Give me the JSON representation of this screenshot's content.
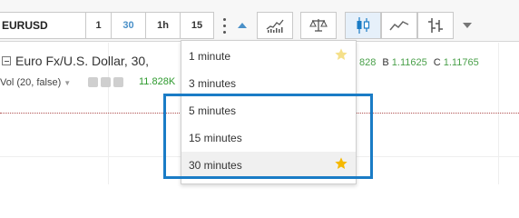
{
  "toolbar": {
    "symbol": "EURUSD",
    "timeframes": [
      "1",
      "30",
      "1h",
      "15"
    ],
    "active_timeframe": "30",
    "icons": [
      "more-options-icon",
      "collapse-caret-icon",
      "indicators-icon",
      "compare-icon",
      "candles-icon",
      "line-chart-icon",
      "bars-icon",
      "chevron-down-icon"
    ]
  },
  "legend": {
    "title": "Euro Fx/U.S. Dollar, 30,",
    "ohlc": [
      {
        "label": "",
        "value": "828"
      },
      {
        "label": "B",
        "value": "1.11625"
      },
      {
        "label": "C",
        "value": "1.11765"
      }
    ],
    "volume_label": "Vol (20, false)",
    "volume_value": "11.828K"
  },
  "dropdown": {
    "items": [
      {
        "label": "1 minute",
        "favorite": true,
        "star_color": "#f5e08a"
      },
      {
        "label": "3 minutes",
        "favorite": false
      },
      {
        "label": "5 minutes",
        "favorite": false
      },
      {
        "label": "15 minutes",
        "favorite": false
      },
      {
        "label": "30 minutes",
        "favorite": true,
        "star_color": "#f5b800",
        "hovered": true
      }
    ]
  },
  "colors": {
    "accent": "#4a90c8",
    "highlight": "#1a7cc6",
    "positive": "#2e9a2e"
  }
}
